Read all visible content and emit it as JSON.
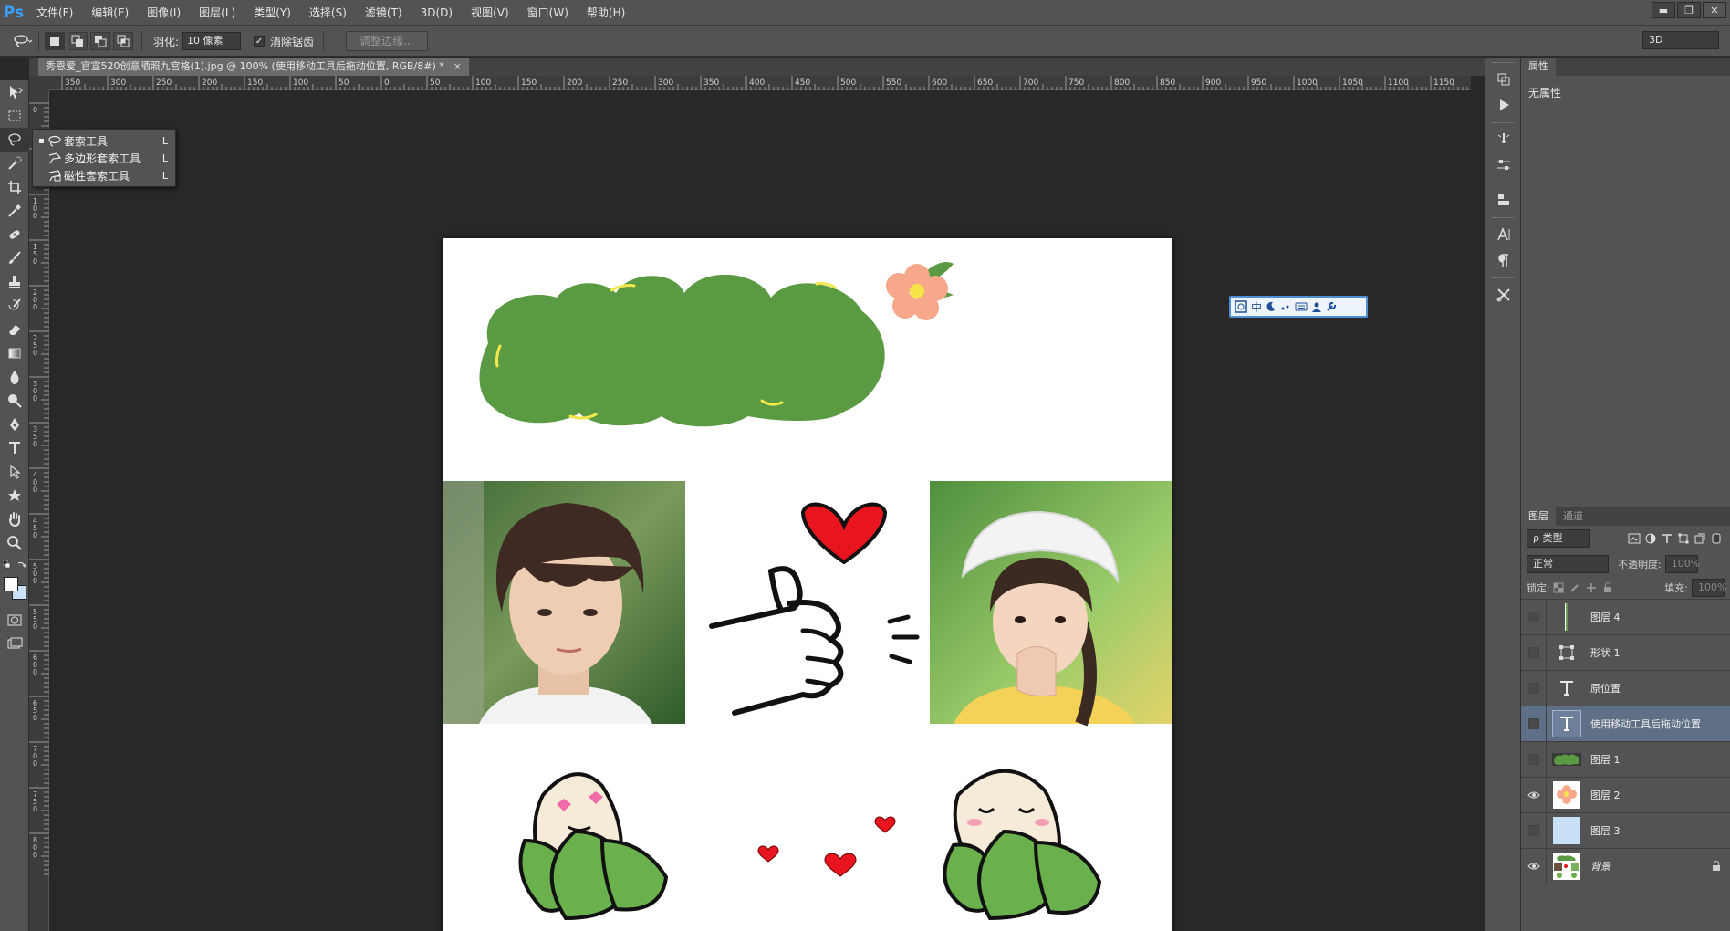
{
  "app": {
    "logo": "Ps"
  },
  "menu": [
    "文件(F)",
    "编辑(E)",
    "图像(I)",
    "图层(L)",
    "类型(Y)",
    "选择(S)",
    "滤镜(T)",
    "3D(D)",
    "视图(V)",
    "窗口(W)",
    "帮助(H)"
  ],
  "window_controls": {
    "minimize": "▬",
    "restore": "❐",
    "close": "✕"
  },
  "options": {
    "feather_label": "羽化:",
    "feather_value": "10 像素",
    "antialias_label": "消除锯齿",
    "antialias_checked": "✓",
    "refine_edge_label": "调整边缘...",
    "workspace": "3D"
  },
  "document": {
    "tab_title": "秀恩爱_官宣520创意晒照九宫格(1).jpg @ 100% (使用移动工具后拖动位置, RGB/8#) *",
    "tab_close": "×"
  },
  "ruler": {
    "h_ticks": [
      "350",
      "300",
      "250",
      "200",
      "150",
      "100",
      "50",
      "0",
      "50",
      "100",
      "150",
      "200",
      "250",
      "300",
      "350",
      "400",
      "450",
      "500",
      "550",
      "600",
      "650",
      "700",
      "750",
      "800",
      "850",
      "900",
      "950",
      "1000",
      "1050",
      "1100",
      "1150"
    ],
    "v_ticks": [
      "0",
      "50",
      "100",
      "150",
      "200",
      "250",
      "300",
      "350",
      "400",
      "450",
      "500",
      "550",
      "600",
      "650",
      "700",
      "750",
      "800"
    ]
  },
  "flyout": {
    "items": [
      {
        "label": "套索工具",
        "key": "L",
        "selected": true
      },
      {
        "label": "多边形套索工具",
        "key": "L",
        "selected": false
      },
      {
        "label": "磁性套索工具",
        "key": "L",
        "selected": false
      }
    ],
    "selected_marker": "▪"
  },
  "ime": {
    "zh": "中"
  },
  "properties": {
    "tab": "属性",
    "content": "无属性"
  },
  "layers_panel": {
    "tabs": [
      "图层",
      "通道"
    ],
    "filter_label": "ρ 类型",
    "blend_mode": "正常",
    "opacity_label": "不透明度:",
    "opacity_value": "100%",
    "lock_label": "锁定:",
    "fill_label": "填充:",
    "fill_value": "100%",
    "layers": [
      {
        "name": "图层 4",
        "thumb": "line",
        "visible": false,
        "selected": false,
        "type": "pixel"
      },
      {
        "name": "形状 1",
        "thumb": "shape",
        "visible": false,
        "selected": false,
        "type": "shape"
      },
      {
        "name": "原位置",
        "thumb": "text",
        "visible": false,
        "selected": false,
        "type": "text"
      },
      {
        "name": "使用移动工具后拖动位置",
        "thumb": "text",
        "visible": false,
        "selected": true,
        "type": "text"
      },
      {
        "name": "图层 1",
        "thumb": "green-cloud",
        "visible": false,
        "selected": false,
        "type": "pixel"
      },
      {
        "name": "图层 2",
        "thumb": "flower",
        "visible": true,
        "selected": false,
        "type": "pixel"
      },
      {
        "name": "图层 3",
        "thumb": "light-blue",
        "visible": false,
        "selected": false,
        "type": "pixel"
      },
      {
        "name": "背景",
        "thumb": "background",
        "visible": true,
        "selected": false,
        "type": "background",
        "locked": true
      }
    ]
  },
  "colors": {
    "foreground": "#ffffff",
    "background": "#c9e1f7",
    "selected_layer": "#5f6f86",
    "cloud_green": "#5a9a42",
    "heart_red": "#e8141e"
  }
}
